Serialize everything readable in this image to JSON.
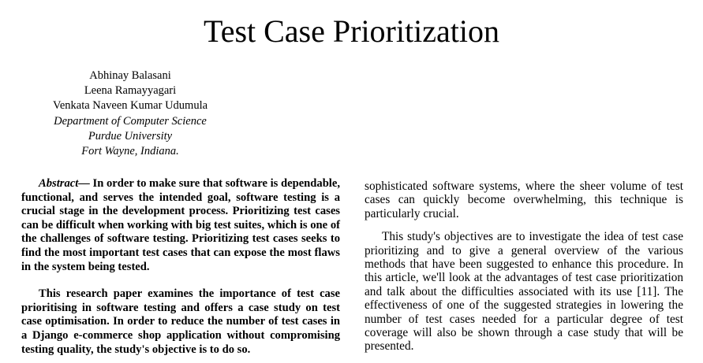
{
  "paper": {
    "title": "Test Case Prioritization",
    "authors": {
      "names": [
        "Abhinay Balasani",
        "Leena Ramayyagari",
        "Venkata Naveen Kumar Udumula"
      ],
      "department": "Department of Computer Science",
      "university": "Purdue University",
      "location": "Fort Wayne, Indiana."
    },
    "abstract": {
      "lead": "Abstract—",
      "text": " In order to make sure that software is dependable, functional, and serves the intended goal, software testing is a crucial stage in the development process. Prioritizing test cases can be difficult when working with big test suites, which is one of the challenges of software testing. Prioritizing test cases seeks to find the most important test cases that can expose the most flaws in the system being tested.",
      "paragraph2": "This research paper examines the importance of test case prioritising in software testing and offers a case study on test case optimisation. In order to reduce the number of test cases in a Django e-commerce shop application without compromising testing quality, the study's objective is to do so."
    },
    "body": {
      "paragraph1": "sophisticated software systems, where the sheer volume of test cases can quickly become overwhelming, this technique is particularly crucial.",
      "paragraph2": "This study's objectives are to investigate the idea of test case prioritizing and to give a general overview of the various methods that have been suggested to enhance this procedure. In this article, we'll look at the advantages of test case prioritization and talk about the difficulties associated with its use [11]. The effectiveness of one of the suggested strategies in lowering the number of test cases needed for a particular degree of test coverage will also be shown through a case study that will be presented."
    }
  }
}
